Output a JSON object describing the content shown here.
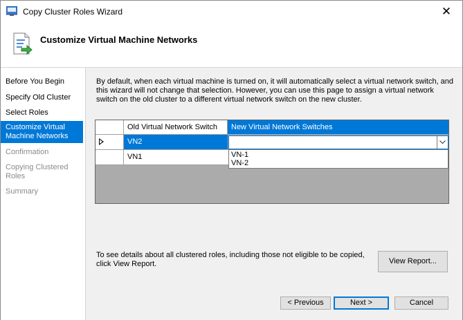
{
  "window": {
    "title": "Copy Cluster Roles Wizard",
    "close_glyph": "✕"
  },
  "header": {
    "title": "Customize Virtual Machine Networks"
  },
  "nav": {
    "items": [
      {
        "label": "Before You Begin",
        "state": "normal"
      },
      {
        "label": "Specify Old Cluster",
        "state": "normal"
      },
      {
        "label": "Select Roles",
        "state": "normal"
      },
      {
        "label": "Customize Virtual Machine Networks",
        "state": "active"
      },
      {
        "label": "Confirmation",
        "state": "disabled"
      },
      {
        "label": "Copying Clustered Roles",
        "state": "disabled"
      },
      {
        "label": "Summary",
        "state": "disabled"
      }
    ]
  },
  "main": {
    "description": "By default, when each virtual machine is turned on, it will automatically select a virtual network switch, and this wizard will not change that selection. However, you can use this page to assign a virtual network switch on the old cluster to a different virtual network switch on the new cluster.",
    "grid": {
      "columns": [
        "Old Virtual Network Switch",
        "New Virtual Network Switches"
      ],
      "rows": [
        {
          "old": "VN2",
          "new": ""
        },
        {
          "old": "VN1",
          "new": ""
        }
      ],
      "dropdown_options": [
        "VN-1",
        "VN-2"
      ]
    },
    "note": "To see details about all clustered roles, including those not eligible to be copied, click View Report.",
    "view_report_label": "View Report..."
  },
  "footer": {
    "previous_label": "< Previous",
    "next_label": "Next >",
    "cancel_label": "Cancel"
  },
  "colors": {
    "accent": "#0078d7",
    "background": "#f0f0f0",
    "disabled_text": "#8a8a8a"
  }
}
